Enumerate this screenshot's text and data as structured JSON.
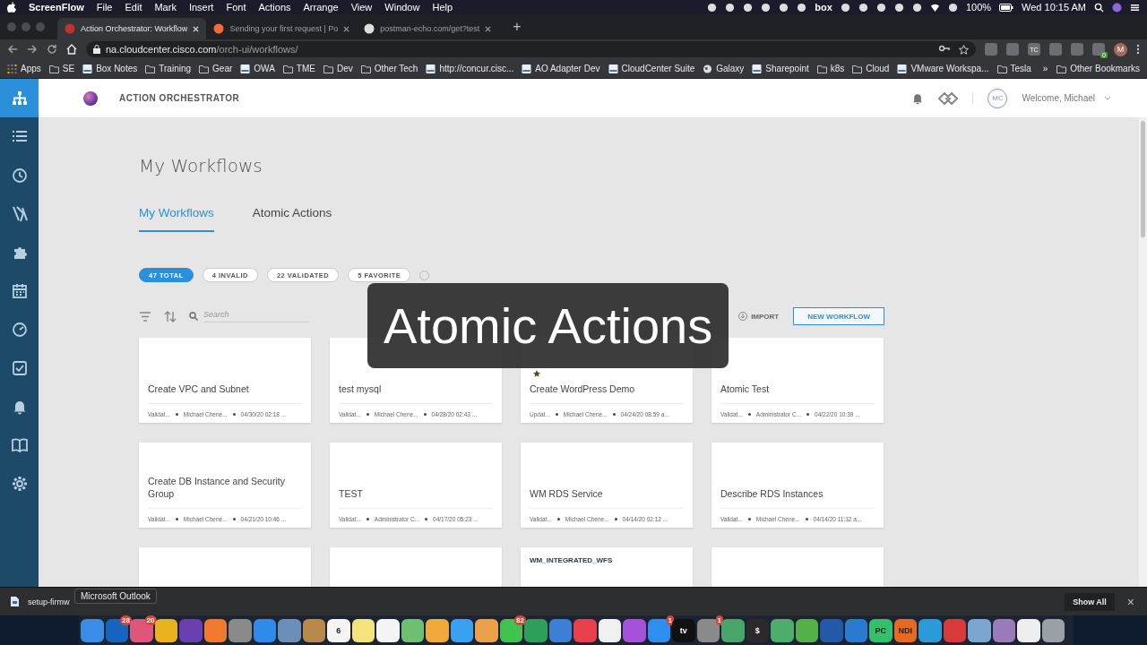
{
  "menubar": {
    "app": "ScreenFlow",
    "menus": [
      "File",
      "Edit",
      "Mark",
      "Insert",
      "Font",
      "Actions",
      "Arrange",
      "View",
      "Window",
      "Help"
    ],
    "status": [
      {
        "kind": "glyph"
      },
      {
        "kind": "glyph"
      },
      {
        "kind": "glyph"
      },
      {
        "kind": "glyph"
      },
      {
        "kind": "glyph"
      },
      {
        "kind": "glyph"
      },
      {
        "kind": "text",
        "label": "box"
      },
      {
        "kind": "glyph"
      },
      {
        "kind": "glyph"
      },
      {
        "kind": "glyph"
      },
      {
        "kind": "glyph"
      },
      {
        "kind": "glyph"
      },
      {
        "kind": "wifi"
      },
      {
        "kind": "glyph"
      }
    ],
    "battery": "100%",
    "clock": "Wed 10:15 AM"
  },
  "browser": {
    "tabs": [
      {
        "title": "Action Orchestrator: Workflow",
        "selected": true
      },
      {
        "title": "Sending your first request | Po",
        "selected": false
      },
      {
        "title": "postman-echo.com/get?test",
        "selected": false
      }
    ],
    "new_tab": "+",
    "url_host": "na.cloudcenter.cisco.com",
    "url_path": "/orch-ui/workflows/",
    "extensions": [
      {
        "kind": "glyph"
      },
      {
        "kind": "glyph"
      },
      {
        "kind": "text",
        "label": "TC"
      },
      {
        "kind": "glyph"
      },
      {
        "kind": "glyph"
      },
      {
        "kind": "badge",
        "label": "0"
      }
    ],
    "profile": "M",
    "bookmarks": [
      {
        "kind": "apps",
        "label": "Apps"
      },
      {
        "kind": "folder",
        "label": "SE"
      },
      {
        "kind": "site",
        "label": "Box Notes"
      },
      {
        "kind": "folder",
        "label": "Training"
      },
      {
        "kind": "folder",
        "label": "Gear"
      },
      {
        "kind": "site",
        "label": "OWA"
      },
      {
        "kind": "folder",
        "label": "TME"
      },
      {
        "kind": "folder",
        "label": "Dev"
      },
      {
        "kind": "folder",
        "label": "Other Tech"
      },
      {
        "kind": "site",
        "label": "http://concur.cisc..."
      },
      {
        "kind": "site",
        "label": "AO Adapter Dev"
      },
      {
        "kind": "site",
        "label": "CloudCenter Suite"
      },
      {
        "kind": "globe",
        "label": "Galaxy"
      },
      {
        "kind": "site",
        "label": "Sharepoint"
      },
      {
        "kind": "folder",
        "label": "k8s"
      },
      {
        "kind": "folder",
        "label": "Cloud"
      },
      {
        "kind": "site",
        "label": "VMware Workspa..."
      },
      {
        "kind": "folder",
        "label": "Tesla"
      }
    ],
    "more": "»",
    "other_bookmarks": "Other Bookmarks"
  },
  "app": {
    "title": "ACTION ORCHESTRATOR",
    "user_initials": "MC",
    "welcome": "Welcome, Michael",
    "sidebar": [
      {
        "kind": "hierarchy",
        "selected": true
      },
      {
        "kind": "list",
        "selected": false
      },
      {
        "kind": "history",
        "selected": false
      },
      {
        "kind": "tools",
        "selected": false
      },
      {
        "kind": "puzzle",
        "selected": false
      },
      {
        "kind": "calendar",
        "selected": false
      },
      {
        "kind": "gauge",
        "selected": false
      },
      {
        "kind": "checklist",
        "selected": false
      },
      {
        "kind": "bell",
        "selected": false
      },
      {
        "kind": "book",
        "selected": false
      },
      {
        "kind": "gear",
        "selected": false
      }
    ],
    "page_title": "My Workflows",
    "tabs": [
      {
        "label": "My Workflows",
        "selected": true
      },
      {
        "label": "Atomic Actions",
        "selected": false
      }
    ],
    "filters": [
      {
        "label": "47 TOTAL",
        "selected": true
      },
      {
        "label": "4 INVALID",
        "selected": false
      },
      {
        "label": "22 VALIDATED",
        "selected": false
      },
      {
        "label": "5 FAVORITE",
        "selected": false
      }
    ],
    "search": {
      "placeholder": "Search"
    },
    "import": "IMPORT",
    "new_workflow": "NEW WORKFLOW",
    "cards": [
      {
        "kind": "full",
        "title": "Create VPC and Subnet",
        "status": "Validat...",
        "author": "Michael Chene...",
        "date": "04/30/20 02:18 ...",
        "favorite": false
      },
      {
        "kind": "full",
        "title": "test mysql",
        "status": "Validat...",
        "author": "Michael Chene...",
        "date": "04/28/20 02:43 ...",
        "favorite": false
      },
      {
        "kind": "full",
        "title": "Create WordPress Demo",
        "status": "Updat...",
        "author": "Michael Chene...",
        "date": "04/24/20 08:59 a...",
        "favorite": true
      },
      {
        "kind": "full",
        "title": "Atomic Test",
        "status": "Validat...",
        "author": "Administrator C...",
        "date": "04/22/20 10:39 ...",
        "favorite": false
      },
      {
        "kind": "full",
        "title": "Create DB Instance and Security Group",
        "status": "Validat...",
        "author": "Michael Chene...",
        "date": "04/21/20 10:46 ...",
        "favorite": false
      },
      {
        "kind": "full",
        "title": "TEST",
        "status": "Validat...",
        "author": "Administrator C...",
        "date": "04/17/20 05:23 ...",
        "favorite": false
      },
      {
        "kind": "full",
        "title": "WM RDS Service",
        "status": "Validat...",
        "author": "Michael Chene...",
        "date": "04/14/20 02:12 ...",
        "favorite": false
      },
      {
        "kind": "full",
        "title": "Describe RDS Instances",
        "status": "Validat...",
        "author": "Michael Chene...",
        "date": "04/14/20 11:32 a...",
        "favorite": false
      },
      {
        "kind": "partial"
      },
      {
        "kind": "partial"
      },
      {
        "kind": "partial",
        "tag": "WM_INTEGRATED_WFS"
      },
      {
        "kind": "partial"
      }
    ]
  },
  "caption": "Atomic Actions",
  "download_bar": {
    "file": "setup-firmw",
    "show_all": "Show All",
    "close": "×"
  },
  "tooltip": "Microsoft Outlook",
  "dock": [
    {
      "color": "#3b8ee8"
    },
    {
      "color": "#1565c0",
      "badge": "28"
    },
    {
      "color": "#e0557a",
      "badge": "20"
    },
    {
      "color": "#e8b31c"
    },
    {
      "color": "#6a3fb0"
    },
    {
      "color": "#f07a2e"
    },
    {
      "color": "#8a8a8a"
    },
    {
      "color": "#2f8bea"
    },
    {
      "color": "#6c8fb8"
    },
    {
      "color": "#b58a4a"
    },
    {
      "color": "#f4f4f4",
      "label": "6"
    },
    {
      "color": "#f4e27a"
    },
    {
      "color": "#f4f4f4"
    },
    {
      "color": "#6fbf73"
    },
    {
      "color": "#f2a93b"
    },
    {
      "color": "#3aa0f0"
    },
    {
      "color": "#e9a24a"
    },
    {
      "color": "#3ec44f",
      "badge": "82"
    },
    {
      "color": "#2e9e5b"
    },
    {
      "color": "#3e7fd6"
    },
    {
      "color": "#e8404a"
    },
    {
      "color": "#f0f0f0"
    },
    {
      "color": "#a452d8"
    },
    {
      "color": "#2e8ff0",
      "badge": "1"
    },
    {
      "color": "#111111",
      "label": "tv"
    },
    {
      "color": "#8a8a8a",
      "badge": "1"
    },
    {
      "color": "#4aa56a"
    },
    {
      "color": "#2a2a2a",
      "label": "$"
    },
    {
      "color": "#4cae6a"
    },
    {
      "color": "#56b04a"
    },
    {
      "color": "#2458a8"
    },
    {
      "color": "#2a7ad0"
    },
    {
      "color": "#34c06a",
      "label": "PC"
    },
    {
      "color": "#e86a1e",
      "label": "NDI"
    },
    {
      "color": "#2a9ad8"
    },
    {
      "color": "#d83a3a"
    },
    {
      "color": "#7aa6d0"
    },
    {
      "color": "#9a7ab8"
    },
    {
      "color": "#eeeeee"
    },
    {
      "color": "#9aa0a6"
    }
  ]
}
